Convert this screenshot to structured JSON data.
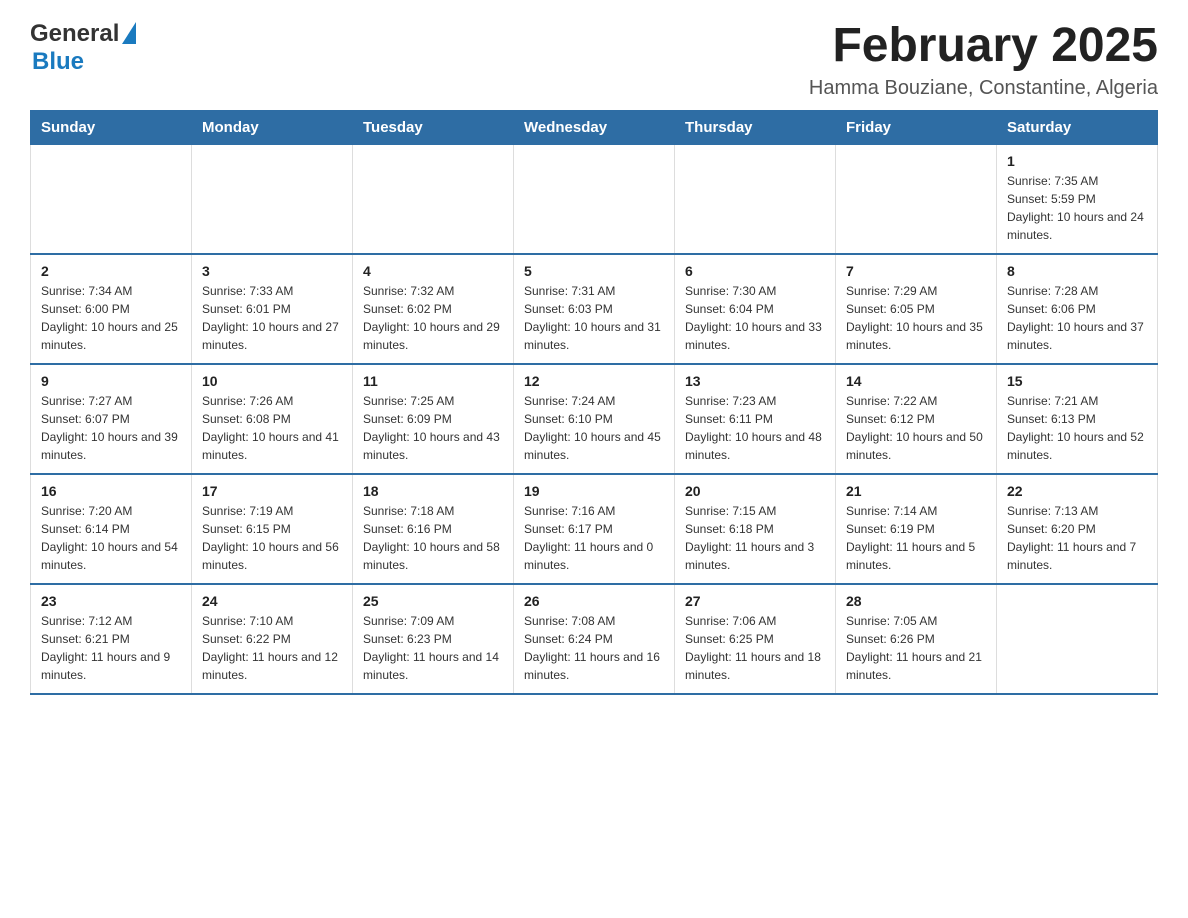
{
  "header": {
    "logo_general": "General",
    "logo_blue": "Blue",
    "month_title": "February 2025",
    "location": "Hamma Bouziane, Constantine, Algeria"
  },
  "days_header": [
    "Sunday",
    "Monday",
    "Tuesday",
    "Wednesday",
    "Thursday",
    "Friday",
    "Saturday"
  ],
  "weeks": [
    [
      {
        "day": "",
        "sunrise": "",
        "sunset": "",
        "daylight": ""
      },
      {
        "day": "",
        "sunrise": "",
        "sunset": "",
        "daylight": ""
      },
      {
        "day": "",
        "sunrise": "",
        "sunset": "",
        "daylight": ""
      },
      {
        "day": "",
        "sunrise": "",
        "sunset": "",
        "daylight": ""
      },
      {
        "day": "",
        "sunrise": "",
        "sunset": "",
        "daylight": ""
      },
      {
        "day": "",
        "sunrise": "",
        "sunset": "",
        "daylight": ""
      },
      {
        "day": "1",
        "sunrise": "Sunrise: 7:35 AM",
        "sunset": "Sunset: 5:59 PM",
        "daylight": "Daylight: 10 hours and 24 minutes."
      }
    ],
    [
      {
        "day": "2",
        "sunrise": "Sunrise: 7:34 AM",
        "sunset": "Sunset: 6:00 PM",
        "daylight": "Daylight: 10 hours and 25 minutes."
      },
      {
        "day": "3",
        "sunrise": "Sunrise: 7:33 AM",
        "sunset": "Sunset: 6:01 PM",
        "daylight": "Daylight: 10 hours and 27 minutes."
      },
      {
        "day": "4",
        "sunrise": "Sunrise: 7:32 AM",
        "sunset": "Sunset: 6:02 PM",
        "daylight": "Daylight: 10 hours and 29 minutes."
      },
      {
        "day": "5",
        "sunrise": "Sunrise: 7:31 AM",
        "sunset": "Sunset: 6:03 PM",
        "daylight": "Daylight: 10 hours and 31 minutes."
      },
      {
        "day": "6",
        "sunrise": "Sunrise: 7:30 AM",
        "sunset": "Sunset: 6:04 PM",
        "daylight": "Daylight: 10 hours and 33 minutes."
      },
      {
        "day": "7",
        "sunrise": "Sunrise: 7:29 AM",
        "sunset": "Sunset: 6:05 PM",
        "daylight": "Daylight: 10 hours and 35 minutes."
      },
      {
        "day": "8",
        "sunrise": "Sunrise: 7:28 AM",
        "sunset": "Sunset: 6:06 PM",
        "daylight": "Daylight: 10 hours and 37 minutes."
      }
    ],
    [
      {
        "day": "9",
        "sunrise": "Sunrise: 7:27 AM",
        "sunset": "Sunset: 6:07 PM",
        "daylight": "Daylight: 10 hours and 39 minutes."
      },
      {
        "day": "10",
        "sunrise": "Sunrise: 7:26 AM",
        "sunset": "Sunset: 6:08 PM",
        "daylight": "Daylight: 10 hours and 41 minutes."
      },
      {
        "day": "11",
        "sunrise": "Sunrise: 7:25 AM",
        "sunset": "Sunset: 6:09 PM",
        "daylight": "Daylight: 10 hours and 43 minutes."
      },
      {
        "day": "12",
        "sunrise": "Sunrise: 7:24 AM",
        "sunset": "Sunset: 6:10 PM",
        "daylight": "Daylight: 10 hours and 45 minutes."
      },
      {
        "day": "13",
        "sunrise": "Sunrise: 7:23 AM",
        "sunset": "Sunset: 6:11 PM",
        "daylight": "Daylight: 10 hours and 48 minutes."
      },
      {
        "day": "14",
        "sunrise": "Sunrise: 7:22 AM",
        "sunset": "Sunset: 6:12 PM",
        "daylight": "Daylight: 10 hours and 50 minutes."
      },
      {
        "day": "15",
        "sunrise": "Sunrise: 7:21 AM",
        "sunset": "Sunset: 6:13 PM",
        "daylight": "Daylight: 10 hours and 52 minutes."
      }
    ],
    [
      {
        "day": "16",
        "sunrise": "Sunrise: 7:20 AM",
        "sunset": "Sunset: 6:14 PM",
        "daylight": "Daylight: 10 hours and 54 minutes."
      },
      {
        "day": "17",
        "sunrise": "Sunrise: 7:19 AM",
        "sunset": "Sunset: 6:15 PM",
        "daylight": "Daylight: 10 hours and 56 minutes."
      },
      {
        "day": "18",
        "sunrise": "Sunrise: 7:18 AM",
        "sunset": "Sunset: 6:16 PM",
        "daylight": "Daylight: 10 hours and 58 minutes."
      },
      {
        "day": "19",
        "sunrise": "Sunrise: 7:16 AM",
        "sunset": "Sunset: 6:17 PM",
        "daylight": "Daylight: 11 hours and 0 minutes."
      },
      {
        "day": "20",
        "sunrise": "Sunrise: 7:15 AM",
        "sunset": "Sunset: 6:18 PM",
        "daylight": "Daylight: 11 hours and 3 minutes."
      },
      {
        "day": "21",
        "sunrise": "Sunrise: 7:14 AM",
        "sunset": "Sunset: 6:19 PM",
        "daylight": "Daylight: 11 hours and 5 minutes."
      },
      {
        "day": "22",
        "sunrise": "Sunrise: 7:13 AM",
        "sunset": "Sunset: 6:20 PM",
        "daylight": "Daylight: 11 hours and 7 minutes."
      }
    ],
    [
      {
        "day": "23",
        "sunrise": "Sunrise: 7:12 AM",
        "sunset": "Sunset: 6:21 PM",
        "daylight": "Daylight: 11 hours and 9 minutes."
      },
      {
        "day": "24",
        "sunrise": "Sunrise: 7:10 AM",
        "sunset": "Sunset: 6:22 PM",
        "daylight": "Daylight: 11 hours and 12 minutes."
      },
      {
        "day": "25",
        "sunrise": "Sunrise: 7:09 AM",
        "sunset": "Sunset: 6:23 PM",
        "daylight": "Daylight: 11 hours and 14 minutes."
      },
      {
        "day": "26",
        "sunrise": "Sunrise: 7:08 AM",
        "sunset": "Sunset: 6:24 PM",
        "daylight": "Daylight: 11 hours and 16 minutes."
      },
      {
        "day": "27",
        "sunrise": "Sunrise: 7:06 AM",
        "sunset": "Sunset: 6:25 PM",
        "daylight": "Daylight: 11 hours and 18 minutes."
      },
      {
        "day": "28",
        "sunrise": "Sunrise: 7:05 AM",
        "sunset": "Sunset: 6:26 PM",
        "daylight": "Daylight: 11 hours and 21 minutes."
      },
      {
        "day": "",
        "sunrise": "",
        "sunset": "",
        "daylight": ""
      }
    ]
  ]
}
